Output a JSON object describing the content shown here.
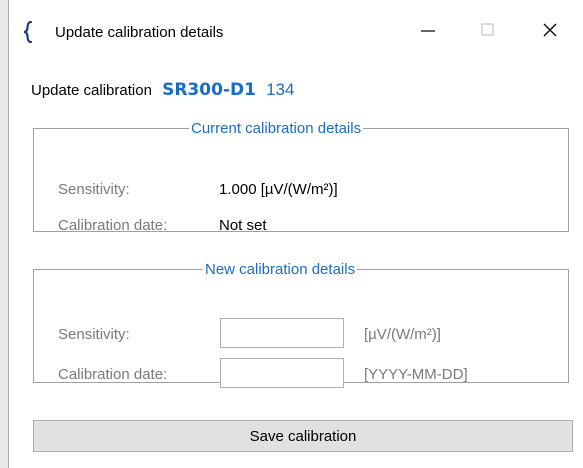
{
  "window": {
    "title": "Update calibration details",
    "app_icon": "brace-icon",
    "controls": [
      "minimize-icon",
      "maximize-icon",
      "close-icon"
    ]
  },
  "heading": {
    "prefix": "Update calibration",
    "model": "SR300-D1",
    "serial": "134"
  },
  "current": {
    "legend": "Current calibration details",
    "sensitivity_label": "Sensitivity:",
    "sensitivity_value": "1.000 [µV/(W/m²)]",
    "date_label": "Calibration date:",
    "date_value": "Not set"
  },
  "new": {
    "legend": "New calibration details",
    "sensitivity_label": "Sensitivity:",
    "sensitivity_input": "",
    "sensitivity_unit": "[µV/(W/m²)]",
    "date_label": "Calibration date:",
    "date_input": "",
    "date_format": "[YYYY-MM-DD]"
  },
  "actions": {
    "save_label": "Save calibration"
  },
  "colors": {
    "accent": "#1a6dc6",
    "muted_label": "#7a7a7a",
    "button_bg": "#e1e1e1"
  }
}
